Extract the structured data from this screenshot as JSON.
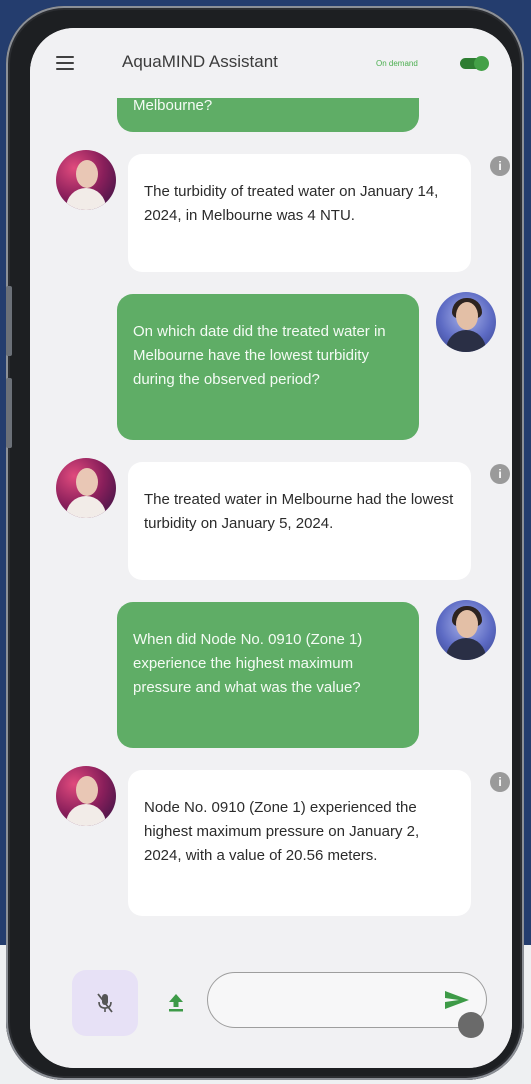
{
  "header": {
    "title": "AquaMIND Assistant",
    "demand_label": "On demand"
  },
  "messages": {
    "prev_user_tail": "Melbourne?",
    "bot_1": "The turbidity of treated water on January 14, 2024, in Melbourne was 4 NTU.",
    "user_1": "On which date did the treated water in Melbourne have the lowest turbidity during the observed period?",
    "bot_2": "The treated water in Melbourne had the lowest turbidity on January 5, 2024.",
    "user_2": "When did Node No. 0910 (Zone 1) experience the highest maximum pressure and what was the value?",
    "bot_3": "Node No. 0910 (Zone 1) experienced the highest maximum pressure on January 2, 2024, with a value of 20.56 meters."
  },
  "info_glyph": "i",
  "input": {
    "placeholder": ""
  },
  "colors": {
    "user_bubble": "#5fad66",
    "toggle_on": "#2e7d32",
    "mic_button": "#e7e1f6"
  },
  "icons": [
    "menu-icon",
    "mic-off-icon",
    "upload-icon",
    "send-icon",
    "info-icon"
  ]
}
